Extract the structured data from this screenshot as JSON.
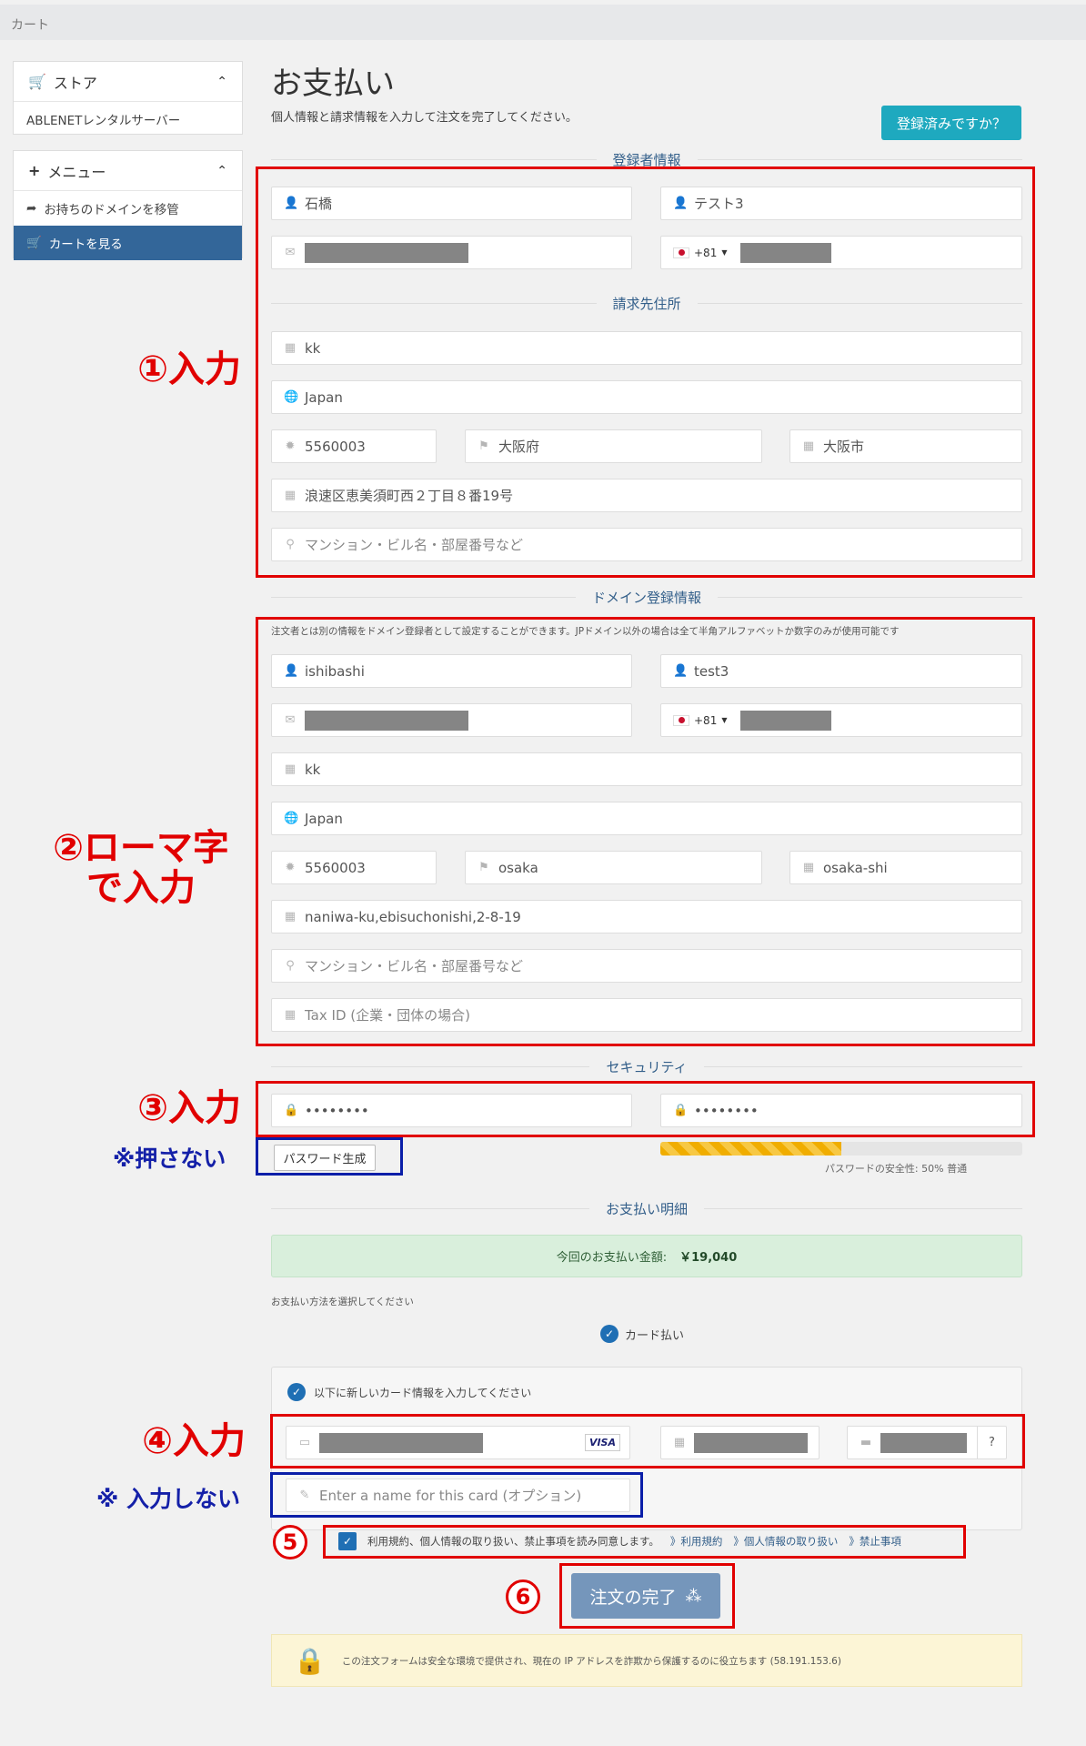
{
  "breadcrumb": "カート",
  "sidebar": {
    "store_title": "ストア",
    "store_item": "ABLENETレンタルサーバー",
    "menu_title": "メニュー",
    "menu_items": [
      "お持ちのドメインを移管",
      "カートを見る"
    ]
  },
  "page": {
    "title": "お支払い",
    "subtitle": "個人情報と請求情報を入力して注文を完了してください。",
    "registered_button": "登録済みですか？"
  },
  "sections": {
    "registrant": "登録者情報",
    "billing": "請求先住所",
    "domain": "ドメイン登録情報",
    "security": "セキュリティ",
    "payment": "お支払い明細"
  },
  "registrant": {
    "last_name": "石橋",
    "first_name": "テスト3",
    "phone_code": "+81"
  },
  "billing": {
    "company": "kk",
    "country": "Japan",
    "postcode": "5560003",
    "state": "大阪府",
    "city": "大阪市",
    "address1": "浪速区恵美須町西２丁目８番19号",
    "address2_placeholder": "マンション・ビル名・部屋番号など"
  },
  "domain_contact": {
    "note": "注文者とは別の情報をドメイン登録者として設定することができます。JPドメイン以外の場合は全て半角アルファベットか数字のみが使用可能です",
    "last_name": "ishibashi",
    "first_name": "test3",
    "phone_code": "+81",
    "company": "kk",
    "country": "Japan",
    "postcode": "5560003",
    "state": "osaka",
    "city": "osaka-shi",
    "address1": "naniwa-ku,ebisuchonishi,2-8-19",
    "address2_placeholder": "マンション・ビル名・部屋番号など",
    "tax_id_placeholder": "Tax ID (企業・団体の場合)"
  },
  "security": {
    "password": "••••••••",
    "password_confirm": "••••••••",
    "generate_button": "パスワード生成",
    "strength_percent": 50,
    "strength_text": "パスワードの安全性: 50% 普通"
  },
  "payment": {
    "total_label": "今回のお支払い金額:",
    "total_value": "￥19,040",
    "method_prompt": "お支払い方法を選択してください",
    "method_label": "カード払い",
    "new_card_label": "以下に新しいカード情報を入力してください",
    "card_brand": "VISA",
    "cvv_help": "?",
    "card_name_placeholder": "Enter a name for this card (オプション)",
    "tos_text": "利用規約、個人情報の取り扱い、禁止事項を読み同意します。",
    "tos_links": [
      "》利用規約",
      "》個人情報の取り扱い",
      "》禁止事項"
    ],
    "submit_label": "注文の完了"
  },
  "secure_notice": "この注文フォームは安全な環境で提供され、現在の IP アドレスを詐欺から保護するのに役立ちます (58.191.153.6)",
  "annotations": {
    "a1": "①入力",
    "a2_line1": "②ローマ字",
    "a2_line2": "で入力",
    "a3": "③入力",
    "a3_note": "※押さない",
    "a4": "④入力",
    "a4_note": "※ 入力しない",
    "a5": "5",
    "a6": "6"
  },
  "colors": {
    "annotation_red": "#e10000",
    "annotation_blue": "#0a1ea8",
    "primary": "#336699",
    "teal": "#1ea9bf"
  }
}
